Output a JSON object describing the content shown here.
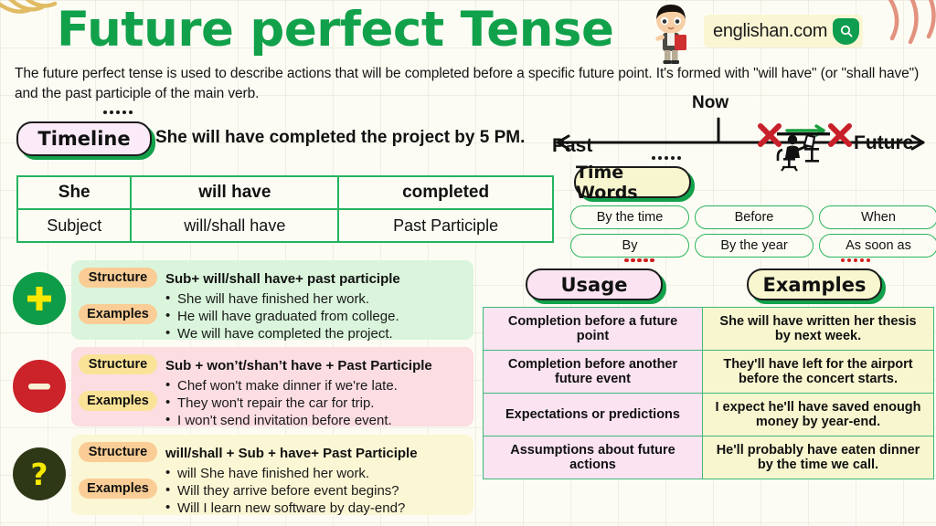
{
  "header": {
    "title": "Future perfect Tense",
    "logo_text": "englishan.com",
    "search_icon": "magnifier-icon",
    "mascot_icon": "boy-with-book-icon",
    "intro": "The future perfect tense is used to describe actions that will be completed before a specific future point. It's formed with \"will have\" (or \"shall have\") and the past participle of the main verb."
  },
  "timeline": {
    "badge_label": "Timeline",
    "sentence": "She will have completed the project by 5 PM.",
    "now_label": "Now",
    "past_label": "Past",
    "future_label": "Future",
    "person_icon": "person-at-desk-icon",
    "marker_icon": "red-x-icon",
    "progress_icon": "green-arrow-icon"
  },
  "grammar_table": {
    "row_example": [
      "She",
      "will have",
      "completed"
    ],
    "row_roles": [
      "Subject",
      "will/shall have",
      "Past Participle"
    ]
  },
  "time_words": {
    "badge_label": "Time Words",
    "items": [
      "By the time",
      "Before",
      "When",
      "By",
      "By the year",
      "As soon as"
    ]
  },
  "forms": [
    {
      "sign": "+",
      "sign_name": "plus-icon",
      "structure_label": "Structure",
      "examples_label": "Examples",
      "structure": "Sub+ will/shall have+ past participle",
      "examples": [
        "She will have finished her work.",
        "He will have graduated from college.",
        "We will have completed the project."
      ]
    },
    {
      "sign": "–",
      "sign_name": "minus-icon",
      "structure_label": "Structure",
      "examples_label": "Examples",
      "structure": "Sub + won’t/shan’t have + Past Participle",
      "examples": [
        "Chef won't make dinner if we're late.",
        "They won't repair the car for trip.",
        "I won't send invitation before event."
      ]
    },
    {
      "sign": "?",
      "sign_name": "question-mark-icon",
      "structure_label": "Structure",
      "examples_label": "Examples",
      "structure": "will/shall + Sub + have+ Past Participle",
      "examples": [
        "will She have finished her work.",
        "Will they arrive before event begins?",
        "Will I learn new software by day-end?"
      ]
    }
  ],
  "usage_section": {
    "usage_badge": "Usage",
    "examples_badge": "Examples",
    "rows": [
      {
        "usage": "Completion before a future point",
        "example": "She will have written her thesis by next week."
      },
      {
        "usage": "Completion before another future event",
        "example": "They'll have left for the airport before the concert starts."
      },
      {
        "usage": "Expectations or predictions",
        "example": "I expect he'll have saved enough money by year-end."
      },
      {
        "usage": "Assumptions about future actions",
        "example": "He'll probably have eaten dinner by the time we call."
      }
    ]
  },
  "colors": {
    "brand_green": "#12a14b",
    "positive": "#0f9c48",
    "negative": "#cc2229",
    "question": "#2e3817",
    "accent_pink": "#fbe3f1",
    "accent_cream": "#f8f6cf"
  }
}
